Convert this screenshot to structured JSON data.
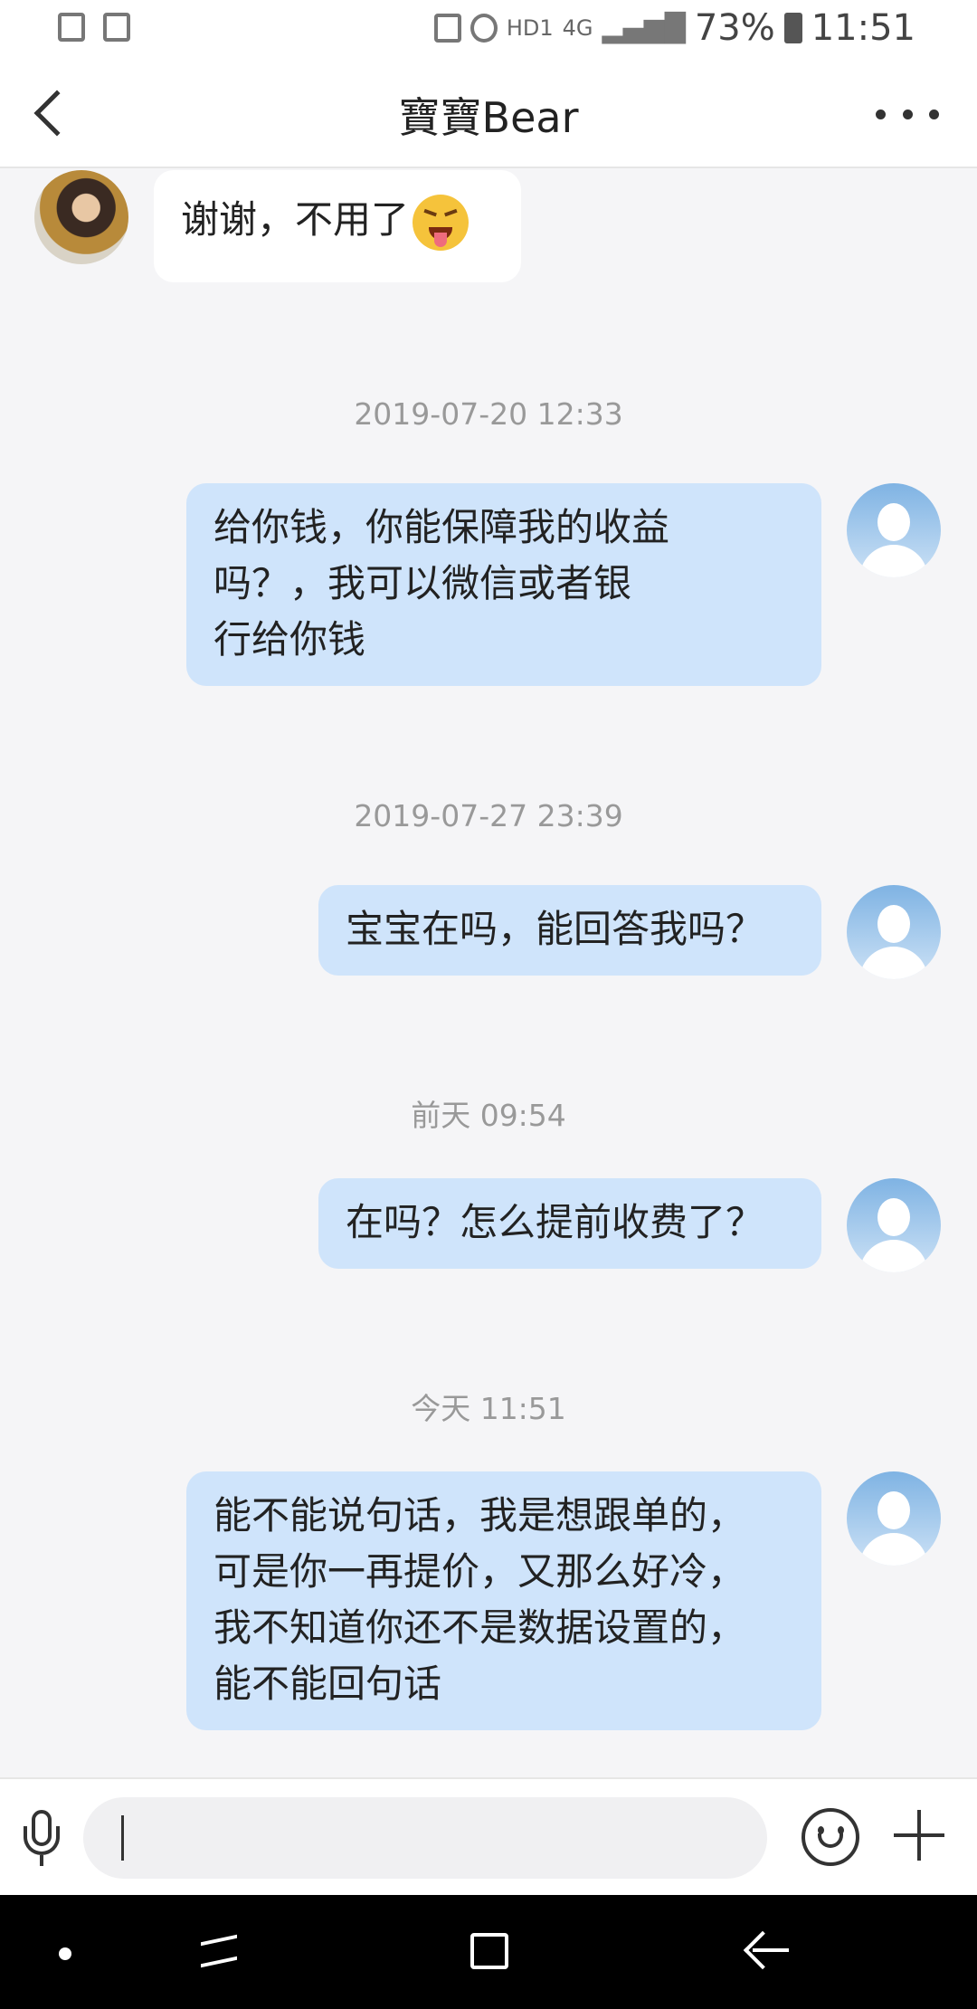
{
  "status_bar": {
    "network": "4G",
    "hd": "HD1",
    "battery": "73%",
    "time": "11:51"
  },
  "header": {
    "title": "寶寶Bear"
  },
  "messages": [
    {
      "type": "incoming",
      "text": "谢谢，不用了"
    },
    {
      "type": "timestamp",
      "text": "2019-07-20 12:33"
    },
    {
      "type": "outgoing",
      "lines": [
        "给你钱，你能保障我的收益",
        "吗？，我可以微信或者银",
        "行给你钱"
      ]
    },
    {
      "type": "timestamp",
      "text": "2019-07-27 23:39"
    },
    {
      "type": "outgoing",
      "lines": [
        "宝宝在吗，能回答我吗？"
      ]
    },
    {
      "type": "timestamp",
      "text": "前天 09:54"
    },
    {
      "type": "outgoing",
      "lines": [
        "在吗？怎么提前收费了？"
      ]
    },
    {
      "type": "timestamp",
      "text": "今天 11:51"
    },
    {
      "type": "outgoing",
      "lines": [
        "能不能说句话，我是想跟单的，",
        "可是你一再提价，又那么好冷，",
        "我不知道你还不是数据设置的，",
        "能不能回句话"
      ]
    }
  ],
  "icons": {
    "emoji_in_message": "squinting-tongue-emoji",
    "self_avatar": "default-user-avatar",
    "other_avatar": "user-photo-avatar"
  },
  "input": {
    "value": ""
  }
}
